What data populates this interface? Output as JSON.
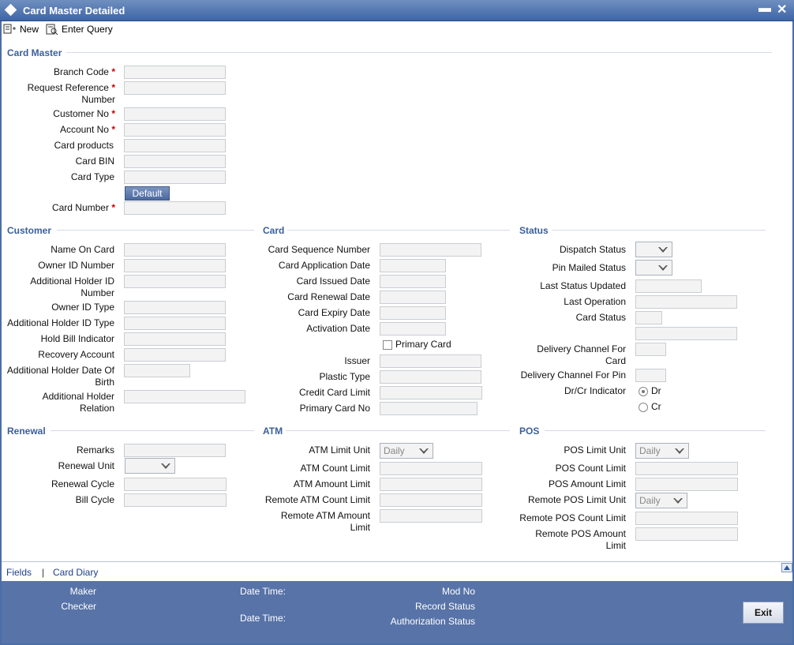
{
  "window": {
    "title": "Card Master Detailed",
    "minimize": "▬",
    "close": "✕"
  },
  "toolbar": {
    "new_label": "New",
    "enter_query_label": "Enter Query"
  },
  "sections": {
    "card_master": "Card Master",
    "customer": "Customer",
    "card": "Card",
    "status": "Status",
    "renewal": "Renewal",
    "atm": "ATM",
    "pos": "POS"
  },
  "card_master": {
    "branch_code": "Branch Code",
    "request_reference_1": "Request Reference",
    "request_reference_2": "Number",
    "customer_no": "Customer No",
    "account_no": "Account No",
    "card_products": "Card products",
    "card_bin": "Card BIN",
    "card_type": "Card Type",
    "default_button": "Default",
    "card_number": "Card Number",
    "required_mark": "*"
  },
  "customer": {
    "name_on_card": "Name On Card",
    "owner_id_number": "Owner ID Number",
    "additional_holder_id_1": "Additional Holder ID",
    "additional_holder_id_2": "Number",
    "owner_id_type": "Owner ID Type",
    "additional_holder_id_type": "Additional Holder ID Type",
    "hold_bill_indicator": "Hold Bill Indicator",
    "recovery_account": "Recovery Account",
    "additional_holder_dob_1": "Additional Holder Date Of",
    "additional_holder_dob_2": "Birth",
    "additional_holder_relation_1": "Additional Holder",
    "additional_holder_relation_2": "Relation"
  },
  "card": {
    "card_sequence_number": "Card Sequence Number",
    "card_application_date": "Card Application Date",
    "card_issued_date": "Card Issued Date",
    "card_renewal_date": "Card Renewal Date",
    "card_expiry_date": "Card Expiry Date",
    "activation_date": "Activation Date",
    "primary_card": "Primary Card",
    "issuer": "Issuer",
    "plastic_type": "Plastic Type",
    "credit_card_limit": "Credit Card Limit",
    "primary_card_no": "Primary Card No"
  },
  "status": {
    "dispatch_status": "Dispatch Status",
    "pin_mailed_status": "Pin Mailed Status",
    "last_status_updated": "Last Status Updated",
    "last_operation": "Last Operation",
    "card_status": "Card Status",
    "delivery_channel_card_1": "Delivery Channel For",
    "delivery_channel_card_2": "Card",
    "delivery_channel_pin": "Delivery Channel For Pin",
    "dr_cr_indicator": "Dr/Cr Indicator",
    "dr": "Dr",
    "cr": "Cr",
    "dr_cr_selected": "Dr"
  },
  "renewal": {
    "remarks": "Remarks",
    "renewal_unit": "Renewal Unit",
    "renewal_cycle": "Renewal Cycle",
    "bill_cycle": "Bill Cycle"
  },
  "atm": {
    "atm_limit_unit": "ATM Limit Unit",
    "atm_limit_unit_value": "Daily",
    "atm_count_limit": "ATM Count Limit",
    "atm_amount_limit": "ATM Amount Limit",
    "remote_atm_count_limit": "Remote ATM Count Limit",
    "remote_atm_amount_limit_1": "Remote ATM Amount",
    "remote_atm_amount_limit_2": "Limit"
  },
  "pos": {
    "pos_limit_unit": "POS Limit Unit",
    "pos_limit_unit_value": "Daily",
    "pos_count_limit": "POS Count Limit",
    "pos_amount_limit": "POS Amount Limit",
    "remote_pos_limit_unit": "Remote POS Limit Unit",
    "remote_pos_limit_unit_value": "Daily",
    "remote_pos_count_limit": "Remote POS Count Limit",
    "remote_pos_amount_limit_1": "Remote POS Amount",
    "remote_pos_amount_limit_2": "Limit"
  },
  "links": {
    "fields": "Fields",
    "separator": "|",
    "card_diary": "Card Diary"
  },
  "footer": {
    "maker": "Maker",
    "checker": "Checker",
    "date_time_1": "Date Time:",
    "date_time_2": "Date Time:",
    "mod_no": "Mod No",
    "record_status": "Record Status",
    "authorization_status": "Authorization Status",
    "exit": "Exit"
  },
  "colors": {
    "title_bar": "#3d65a6",
    "section_text": "#3a5f9a",
    "footer_bg": "#5873a8",
    "required": "#cc0000"
  },
  "icons": [
    "new-icon",
    "enter-query-icon",
    "window-diamond-icon",
    "collapse-up-icon"
  ]
}
